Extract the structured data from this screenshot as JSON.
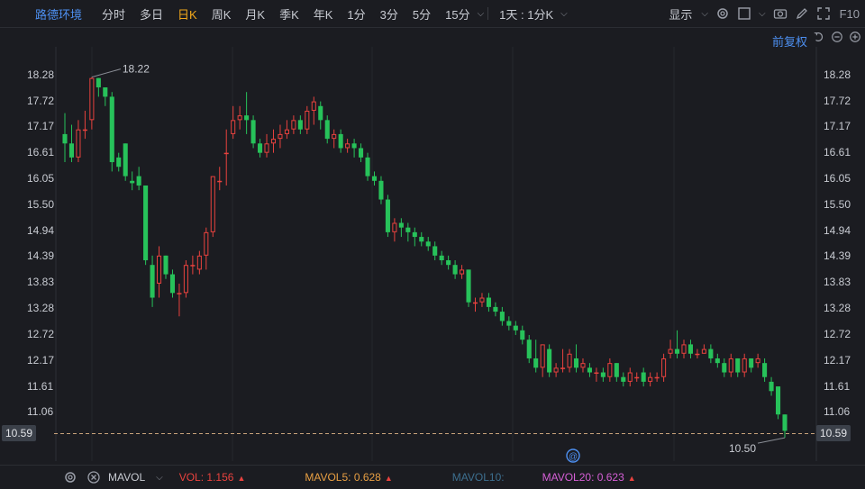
{
  "toolbar": {
    "stock_name": "路德环境",
    "tabs": [
      "分时",
      "多日",
      "日K",
      "周K",
      "月K",
      "季K",
      "年K",
      "1分",
      "3分",
      "5分",
      "15分"
    ],
    "active_tab": "日K",
    "interval_label": "1天 : 1分K",
    "display_label": "显示",
    "f10_label": "F10"
  },
  "adjust_label": "前复权",
  "bottom": {
    "indicator": "MAVOL",
    "vol_label": "VOL: 1.156",
    "mavol5_label": "MAVOL5: 0.628",
    "mavol10_label": "MAVOL10:",
    "mavol20_label": "MAVOL20: 0.623"
  },
  "colors": {
    "up": "#e8423e",
    "down": "#27c25a",
    "mavol5": "#e89f43",
    "mavol10": "#3d6f8f",
    "mavol20": "#d65fd6",
    "link": "#4d8ff0",
    "active": "#f2a81b"
  },
  "chart_data": {
    "type": "candlestick",
    "y_ticks": [
      "18.28",
      "17.72",
      "17.17",
      "16.61",
      "16.05",
      "15.50",
      "14.94",
      "14.39",
      "13.83",
      "13.28",
      "12.72",
      "12.17",
      "11.61",
      "11.06"
    ],
    "ylim": [
      10.59,
      18.28
    ],
    "last_price": "10.59",
    "high_label": "18.22",
    "low_label": "10.50",
    "candles": [
      [
        17.0,
        16.8,
        17.45,
        16.4
      ],
      [
        16.8,
        16.5,
        17.2,
        16.4
      ],
      [
        16.5,
        17.1,
        17.3,
        16.4
      ],
      [
        17.1,
        17.1,
        17.5,
        16.9
      ],
      [
        17.3,
        18.2,
        18.22,
        17.1
      ],
      [
        18.2,
        18.0,
        18.2,
        17.8
      ],
      [
        18.0,
        17.8,
        18.0,
        17.6
      ],
      [
        17.8,
        16.4,
        17.9,
        16.2
      ],
      [
        16.5,
        16.3,
        16.6,
        16.2
      ],
      [
        16.8,
        16.1,
        16.8,
        16.0
      ],
      [
        16.0,
        15.95,
        16.2,
        15.8
      ],
      [
        16.1,
        15.9,
        16.3,
        15.8
      ],
      [
        15.9,
        14.3,
        15.9,
        14.2
      ],
      [
        14.2,
        13.5,
        14.4,
        13.3
      ],
      [
        13.8,
        14.4,
        14.6,
        13.5
      ],
      [
        14.4,
        14.0,
        14.4,
        13.9
      ],
      [
        14.0,
        13.6,
        14.1,
        13.5
      ],
      [
        13.6,
        13.6,
        13.8,
        13.1
      ],
      [
        13.6,
        14.2,
        14.3,
        13.5
      ],
      [
        14.2,
        14.2,
        14.4,
        14.0
      ],
      [
        14.1,
        14.4,
        14.5,
        14.0
      ],
      [
        14.4,
        14.9,
        15.0,
        14.1
      ],
      [
        14.9,
        16.1,
        16.1,
        14.8
      ],
      [
        16.0,
        16.0,
        16.3,
        15.8
      ],
      [
        16.6,
        16.6,
        17.1,
        15.9
      ],
      [
        17.0,
        17.3,
        17.6,
        16.9
      ],
      [
        17.3,
        17.4,
        17.6,
        17.1
      ],
      [
        17.4,
        17.3,
        17.9,
        17.0
      ],
      [
        17.3,
        16.8,
        17.4,
        16.7
      ],
      [
        16.8,
        16.6,
        16.9,
        16.5
      ],
      [
        16.6,
        16.8,
        17.0,
        16.5
      ],
      [
        16.8,
        16.9,
        17.1,
        16.6
      ],
      [
        16.9,
        17.0,
        17.2,
        16.7
      ],
      [
        17.0,
        17.1,
        17.3,
        16.9
      ],
      [
        17.1,
        17.3,
        17.4,
        17.0
      ],
      [
        17.3,
        17.1,
        17.4,
        17.0
      ],
      [
        17.1,
        17.5,
        17.6,
        17.0
      ],
      [
        17.5,
        17.7,
        17.8,
        17.2
      ],
      [
        17.6,
        17.3,
        17.7,
        17.1
      ],
      [
        17.3,
        16.9,
        17.4,
        16.8
      ],
      [
        16.9,
        17.0,
        17.1,
        16.7
      ],
      [
        17.0,
        16.7,
        17.1,
        16.6
      ],
      [
        16.7,
        16.8,
        16.9,
        16.6
      ],
      [
        16.8,
        16.7,
        16.9,
        16.5
      ],
      [
        16.7,
        16.5,
        16.8,
        16.4
      ],
      [
        16.5,
        16.1,
        16.6,
        16.0
      ],
      [
        16.1,
        16.0,
        16.2,
        15.9
      ],
      [
        16.0,
        15.6,
        16.1,
        15.5
      ],
      [
        15.6,
        14.9,
        15.7,
        14.8
      ],
      [
        14.9,
        15.1,
        15.2,
        14.7
      ],
      [
        15.1,
        15.0,
        15.2,
        14.8
      ],
      [
        15.0,
        14.9,
        15.1,
        14.7
      ],
      [
        14.9,
        14.8,
        15.0,
        14.6
      ],
      [
        14.8,
        14.7,
        14.9,
        14.6
      ],
      [
        14.7,
        14.6,
        14.8,
        14.5
      ],
      [
        14.6,
        14.4,
        14.7,
        14.3
      ],
      [
        14.4,
        14.3,
        14.5,
        14.2
      ],
      [
        14.3,
        14.2,
        14.4,
        14.1
      ],
      [
        14.2,
        14.0,
        14.3,
        13.9
      ],
      [
        14.0,
        14.1,
        14.2,
        13.9
      ],
      [
        14.1,
        13.4,
        14.1,
        13.3
      ],
      [
        13.4,
        13.4,
        13.5,
        13.2
      ],
      [
        13.4,
        13.5,
        13.6,
        13.3
      ],
      [
        13.5,
        13.3,
        13.6,
        13.2
      ],
      [
        13.3,
        13.2,
        13.4,
        13.1
      ],
      [
        13.2,
        13.0,
        13.3,
        12.9
      ],
      [
        13.0,
        12.9,
        13.1,
        12.8
      ],
      [
        12.9,
        12.8,
        13.0,
        12.7
      ],
      [
        12.8,
        12.6,
        12.9,
        12.5
      ],
      [
        12.6,
        12.2,
        12.7,
        12.1
      ],
      [
        12.2,
        12.0,
        12.6,
        11.9
      ],
      [
        12.0,
        12.5,
        12.5,
        11.8
      ],
      [
        12.4,
        11.9,
        12.5,
        11.8
      ],
      [
        11.9,
        12.0,
        12.1,
        11.8
      ],
      [
        12.0,
        12.0,
        12.4,
        11.9
      ],
      [
        12.0,
        12.3,
        12.4,
        11.9
      ],
      [
        12.2,
        12.0,
        12.5,
        11.9
      ],
      [
        12.0,
        12.1,
        12.2,
        11.9
      ],
      [
        12.0,
        11.9,
        12.1,
        11.8
      ],
      [
        11.9,
        11.9,
        12.0,
        11.7
      ],
      [
        11.9,
        11.8,
        12.0,
        11.7
      ],
      [
        11.8,
        12.1,
        12.2,
        11.7
      ],
      [
        12.1,
        11.8,
        12.1,
        11.7
      ],
      [
        11.8,
        11.7,
        11.9,
        11.6
      ],
      [
        11.7,
        11.9,
        12.0,
        11.6
      ],
      [
        11.8,
        11.8,
        11.9,
        11.7
      ],
      [
        11.9,
        11.7,
        12.0,
        11.6
      ],
      [
        11.7,
        11.8,
        11.9,
        11.6
      ],
      [
        11.8,
        11.8,
        11.9,
        11.7
      ],
      [
        11.8,
        12.2,
        12.3,
        11.7
      ],
      [
        12.3,
        12.4,
        12.6,
        12.2
      ],
      [
        12.4,
        12.3,
        12.8,
        12.2
      ],
      [
        12.3,
        12.5,
        12.6,
        12.2
      ],
      [
        12.5,
        12.3,
        12.6,
        12.2
      ],
      [
        12.3,
        12.3,
        12.4,
        12.2
      ],
      [
        12.3,
        12.4,
        12.5,
        12.3
      ],
      [
        12.4,
        12.2,
        12.5,
        12.1
      ],
      [
        12.2,
        12.1,
        12.3,
        12.0
      ],
      [
        12.1,
        11.9,
        12.2,
        11.8
      ],
      [
        11.9,
        12.2,
        12.3,
        11.8
      ],
      [
        12.2,
        11.9,
        12.2,
        11.8
      ],
      [
        11.9,
        12.2,
        12.3,
        11.8
      ],
      [
        12.2,
        12.0,
        12.2,
        11.9
      ],
      [
        12.1,
        12.2,
        12.3,
        12.0
      ],
      [
        12.1,
        11.8,
        12.2,
        11.7
      ],
      [
        11.7,
        11.5,
        11.8,
        11.4
      ],
      [
        11.6,
        11.0,
        11.6,
        10.9
      ],
      [
        11.0,
        10.65,
        11.0,
        10.5
      ]
    ]
  }
}
